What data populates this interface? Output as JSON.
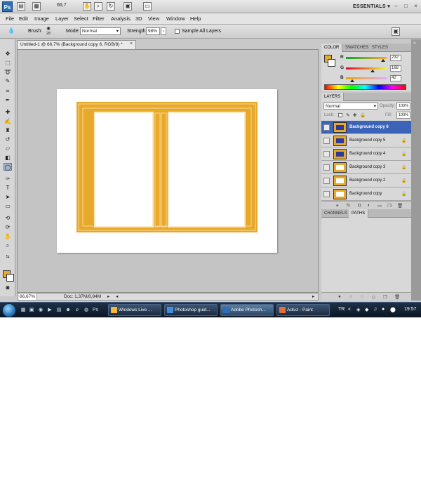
{
  "appbar": {
    "logo": "Ps",
    "zoom": "66,7",
    "workspace": "ESSENTIALS",
    "workspace_arrow": "▾",
    "controls": [
      "–",
      "□",
      "×"
    ]
  },
  "menu": [
    "File",
    "Edit",
    "Image",
    "Layer",
    "Select",
    "Filter",
    "Analysis",
    "3D",
    "View",
    "Window",
    "Help"
  ],
  "options": {
    "brush_label": "Brush:",
    "brush_size": "28",
    "mode_label": "Mode:",
    "mode_value": "Normal",
    "strength_label": "Strength:",
    "strength_value": "98%",
    "sample_all_layers_label": "Sample All Layers"
  },
  "document": {
    "tab_title": "Untitled-1 @ 66,7% (Background copy 6, RGB/8) *",
    "close_glyph": "×",
    "zoom_status": "66,67%",
    "doc_info": "Doc: 1,37M/8,84M"
  },
  "color_panel": {
    "tabs": [
      "COLOR",
      "SWATCHES",
      "STYLES"
    ],
    "channels": [
      {
        "label": "R",
        "value": "232",
        "fraction": 0.91
      },
      {
        "label": "G",
        "value": "168",
        "fraction": 0.66
      },
      {
        "label": "B",
        "value": "42",
        "fraction": 0.16
      }
    ],
    "foreground": "#e8a82a",
    "background": "#ffffff"
  },
  "layers_panel": {
    "tab": "LAYERS",
    "blend_mode": "Normal",
    "opacity_label": "Opacity:",
    "opacity_value": "100%",
    "lock_label": "Lock:",
    "fill_label": "Fill:",
    "fill_value": "100%",
    "layers": [
      {
        "name": "Background copy 6",
        "selected": true,
        "thumb": "#2b3a9e"
      },
      {
        "name": "Background copy 5",
        "selected": false,
        "thumb": "#2b3a9e"
      },
      {
        "name": "Background copy 4",
        "selected": false,
        "thumb": "#2b3a9e"
      },
      {
        "name": "Background copy 3",
        "selected": false,
        "thumb": "#ffffff"
      },
      {
        "name": "Background copy 2",
        "selected": false,
        "thumb": "#ffffff"
      },
      {
        "name": "Background copy",
        "selected": false,
        "thumb": "#ffffff"
      }
    ]
  },
  "channels_panel": {
    "tabs": [
      "CHANNELS",
      "PATHS"
    ]
  },
  "taskbar": {
    "buttons": [
      {
        "label": "Windows Live ...",
        "color": "#f6b73c",
        "active": false
      },
      {
        "label": "Photoshop guid...",
        "color": "#3f8ee0",
        "active": false
      },
      {
        "label": "Adobe Photosh...",
        "color": "#2a6fb8",
        "active": true
      },
      {
        "label": "Adsız - Paint",
        "color": "#e36d3b",
        "active": false
      }
    ],
    "language": "TR",
    "clock": "19:57"
  },
  "colors": {
    "accent_orange": "#e8a82a",
    "selection_blue": "#3b63b8"
  }
}
